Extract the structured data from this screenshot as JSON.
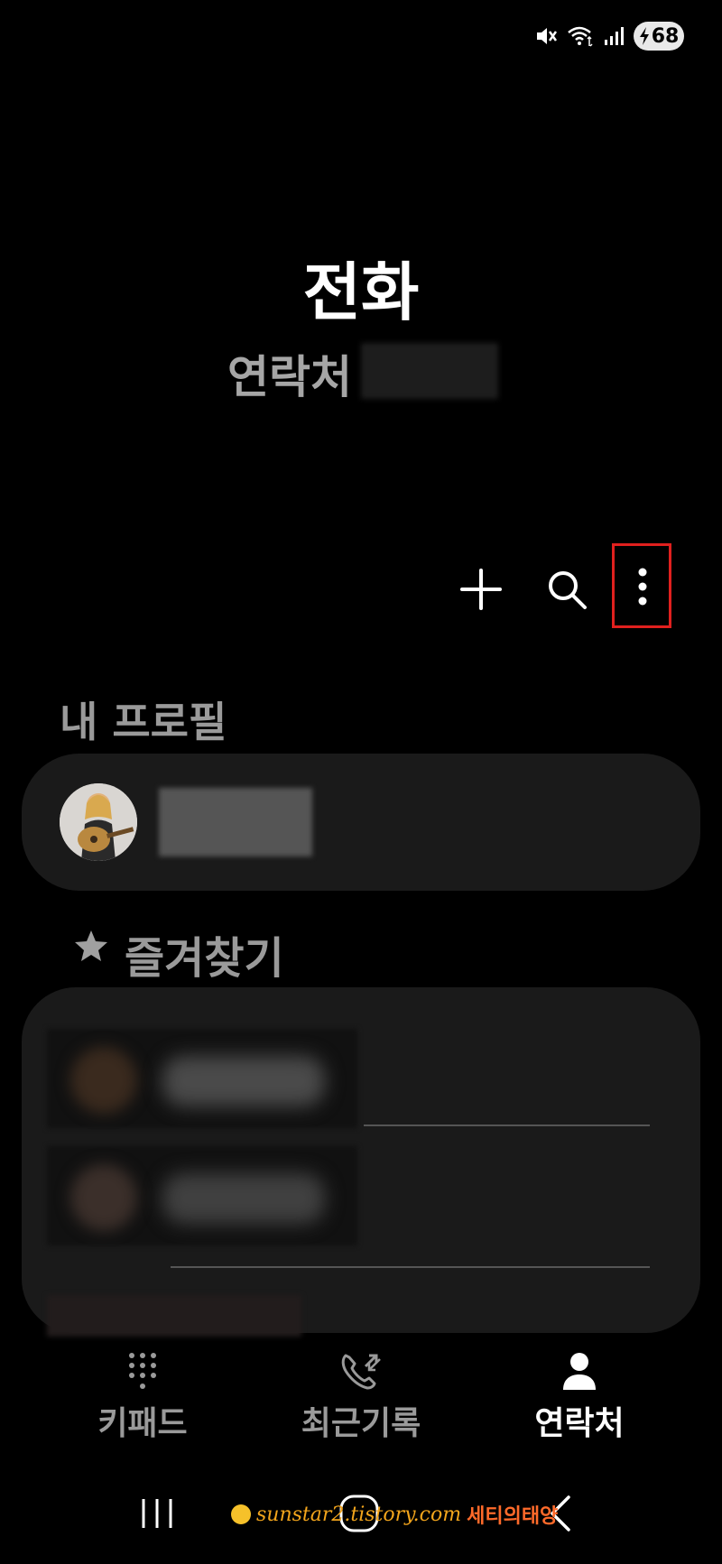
{
  "status_bar": {
    "battery_level": "68",
    "icons": [
      "mute-icon",
      "wifi-icon",
      "signal-icon",
      "battery-charging-icon"
    ]
  },
  "header": {
    "title": "전화",
    "subtitle": "연락처"
  },
  "actions": {
    "icons": [
      "plus-icon",
      "search-icon",
      "more-options-icon"
    ],
    "highlight_color": "#e0201e"
  },
  "profile": {
    "section_label": "내 프로필"
  },
  "favorites": {
    "section_label": "즐겨찾기",
    "icon": "star-icon"
  },
  "bottom_nav": {
    "items": [
      {
        "label": "키패드",
        "icon": "keypad-icon",
        "active": false
      },
      {
        "label": "최근기록",
        "icon": "recent-calls-icon",
        "active": false
      },
      {
        "label": "연락처",
        "icon": "contacts-icon",
        "active": true
      }
    ]
  },
  "watermark": {
    "url_text": "sunstar2.tistory.com",
    "name_text": "세티의태양"
  },
  "colors": {
    "background": "#000000",
    "card": "#1a1a1a",
    "muted_text": "#9a9a9a"
  }
}
